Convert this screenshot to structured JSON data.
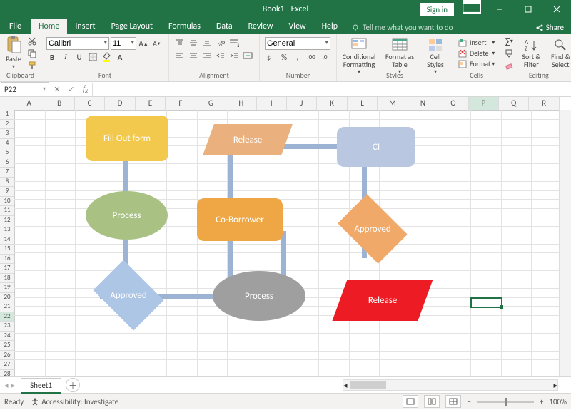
{
  "title": "Book1 - Excel",
  "signin": "Sign in",
  "tabs": {
    "file": "File",
    "home": "Home",
    "insert": "Insert",
    "pageLayout": "Page Layout",
    "formulas": "Formulas",
    "data": "Data",
    "review": "Review",
    "view": "View",
    "help": "Help",
    "search": "Tell me what you want to do",
    "share": "Share"
  },
  "ribbon": {
    "clipboard": {
      "paste": "Paste",
      "label": "Clipboard"
    },
    "font": {
      "name": "Calibri",
      "size": "11",
      "label": "Font",
      "bold": "B",
      "italic": "I",
      "underline": "U"
    },
    "alignment": {
      "label": "Alignment"
    },
    "number": {
      "format": "General",
      "label": "Number"
    },
    "styles": {
      "cond": "Conditional Formatting",
      "table": "Format as Table",
      "cell": "Cell Styles",
      "label": "Styles"
    },
    "cells": {
      "insert": "Insert",
      "delete": "Delete",
      "format": "Format",
      "label": "Cells"
    },
    "editing": {
      "sort": "Sort & Filter",
      "find": "Find & Select",
      "label": "Editing"
    }
  },
  "namebox": "P22",
  "columns": [
    "A",
    "B",
    "C",
    "D",
    "E",
    "F",
    "G",
    "H",
    "I",
    "J",
    "K",
    "L",
    "M",
    "N",
    "O",
    "P",
    "Q",
    "R"
  ],
  "selectedCol": "P",
  "selectedRow": 22,
  "rowCount": 29,
  "sheet": {
    "name": "Sheet1"
  },
  "status": {
    "ready": "Ready",
    "access": "Accessibility: Investigate",
    "zoom": "100%"
  },
  "flow": {
    "shapes": {
      "fillOut": "Fill Out form",
      "process1": "Process",
      "approved1": "Approved",
      "release1": "Release",
      "coBorrower": "Co-Borrower",
      "process2": "Process",
      "ci": "CI",
      "approved2": "Approved",
      "release2": "Release"
    },
    "colors": {
      "yellow": "#f2c94c",
      "green": "#a9c284",
      "blue": "#b9c8e0",
      "lightblue": "#adc6e6",
      "orange": "#eab07e",
      "orangeDark": "#f1a96a",
      "orangeAmber": "#efa644",
      "grey": "#9f9f9f",
      "red": "#ed1c24",
      "conn": "#9db3d4"
    }
  }
}
